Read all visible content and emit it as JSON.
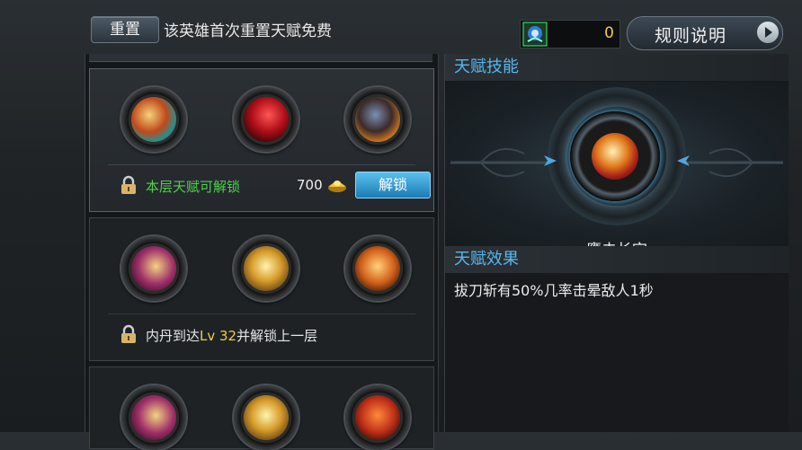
{
  "header": {
    "reset_label": "重置",
    "reset_note": "该英雄首次重置天赋免费",
    "gem_count": "0",
    "rules_label": "规则说明"
  },
  "tiers": [
    {
      "status_text": "本层天赋可解锁",
      "cost": "700",
      "unlock_label": "解锁",
      "skills": [
        "skill-a",
        "skill-b",
        "skill-c"
      ]
    },
    {
      "status_prefix": "内丹到达",
      "status_level": "Lv 32",
      "status_suffix": "并解锁上一层",
      "skills": [
        "skill-d",
        "skill-e",
        "skill-f"
      ]
    },
    {
      "skills": [
        "skill-g",
        "skill-h",
        "skill-i"
      ]
    }
  ],
  "talent_panel": {
    "skill_header": "天赋技能",
    "selected_name": "鹰击长空",
    "effect_header": "天赋效果",
    "effect_text": "拔刀斩有50%几率击晕敌人1秒"
  },
  "colors": {
    "accent_blue": "#57b7ee",
    "unlock_green": "#4cd14a",
    "level_yellow": "#f2c94c"
  }
}
